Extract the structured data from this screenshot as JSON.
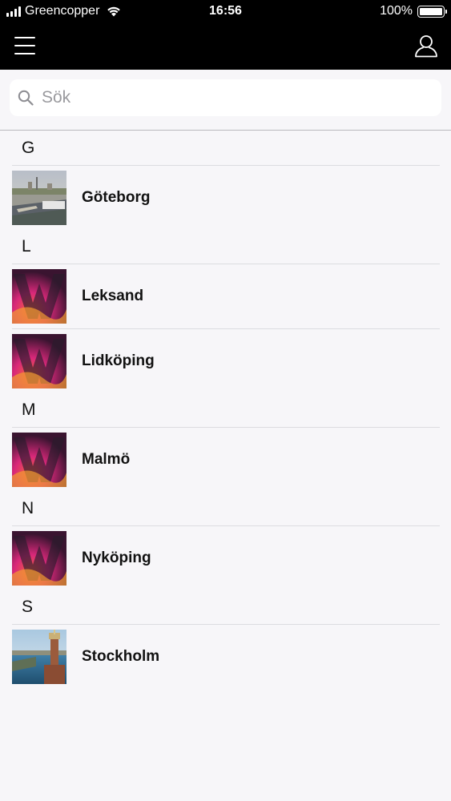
{
  "status_bar": {
    "carrier": "Greencopper",
    "time": "16:56",
    "battery": "100%"
  },
  "nav": {
    "menu_icon": "hamburger-menu-icon",
    "user_icon": "user-profile-icon"
  },
  "search": {
    "placeholder": "Sök",
    "value": ""
  },
  "sections": [
    {
      "letter": "G",
      "items": [
        {
          "name": "Göteborg",
          "thumb": "city-goteborg"
        }
      ]
    },
    {
      "letter": "L",
      "items": [
        {
          "name": "Leksand",
          "thumb": "brand-w"
        },
        {
          "name": "Lidköping",
          "thumb": "brand-w"
        }
      ]
    },
    {
      "letter": "M",
      "items": [
        {
          "name": "Malmö",
          "thumb": "brand-w"
        }
      ]
    },
    {
      "letter": "N",
      "items": [
        {
          "name": "Nyköping",
          "thumb": "brand-w"
        }
      ]
    },
    {
      "letter": "S",
      "items": [
        {
          "name": "Stockholm",
          "thumb": "city-stockholm"
        }
      ]
    }
  ],
  "colors": {
    "bar_background": "#000000",
    "page_background": "#f7f6f9",
    "divider": "#dcdce0"
  }
}
